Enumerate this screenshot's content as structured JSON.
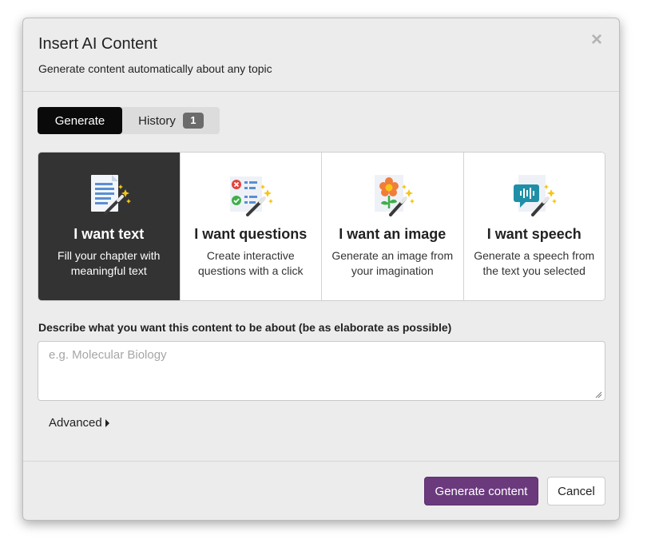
{
  "dialog": {
    "title": "Insert AI Content",
    "subtitle": "Generate content automatically about any topic",
    "close_icon": "close-icon",
    "close_glyph": "×"
  },
  "tabs": [
    {
      "label": "Generate",
      "active": true
    },
    {
      "label": "History",
      "badge": "1",
      "active": false
    }
  ],
  "options": [
    {
      "title": "I want text",
      "description": "Fill your chapter with meaningful text",
      "icon": "document-magic-wand-icon",
      "selected": true
    },
    {
      "title": "I want questions",
      "description": "Create interactive questions with a click",
      "icon": "quiz-magic-wand-icon",
      "selected": false
    },
    {
      "title": "I want an image",
      "description": "Generate an image from your imagination",
      "icon": "flower-image-magic-wand-icon",
      "selected": false
    },
    {
      "title": "I want speech",
      "description": "Generate a speech from the text you selected",
      "icon": "speech-bubble-magic-wand-icon",
      "selected": false
    }
  ],
  "prompt": {
    "label": "Describe what you want this content to be about (be as elaborate as possible)",
    "placeholder": "e.g. Molecular Biology",
    "value": ""
  },
  "advanced": {
    "label": "Advanced",
    "icon": "caret-right-icon"
  },
  "footer": {
    "generate_label": "Generate content",
    "cancel_label": "Cancel"
  },
  "colors": {
    "selected_card": "#333333",
    "active_tab": "#0a0a0a",
    "primary_button": "#6b3a7d",
    "dialog_background": "#ececec"
  }
}
